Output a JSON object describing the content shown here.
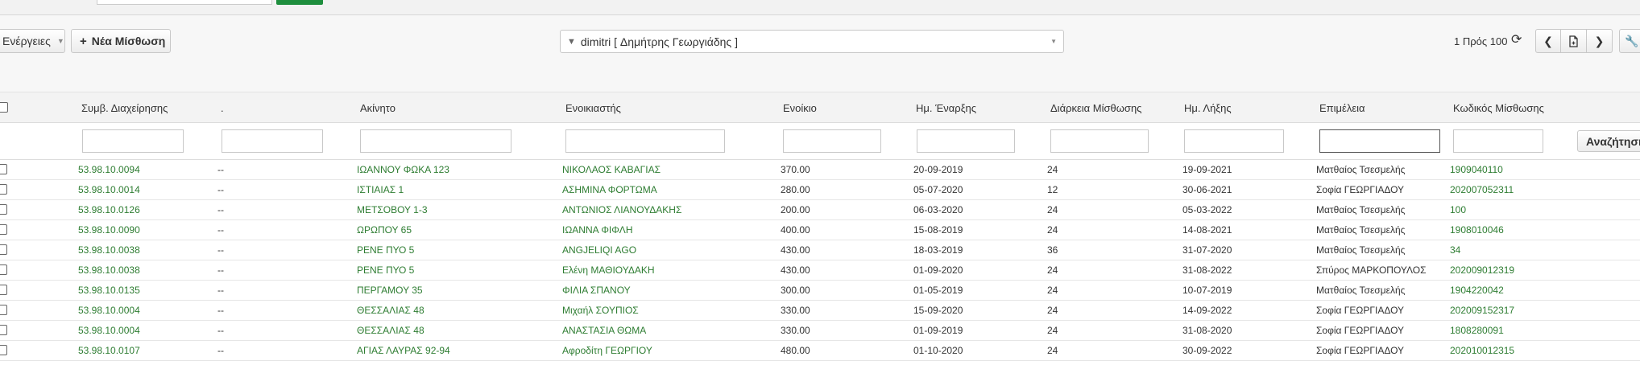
{
  "toolbar": {
    "actions_label": "Ενέργειες",
    "new_lease_label": "Νέα Μίσθωση",
    "filter_value": "dimitri [ Δημήτρης Γεωργιάδης ]",
    "pager_text": "1 Πρός 100"
  },
  "table": {
    "headers": {
      "contract": "Συμβ. Διαχείρησης",
      "dot": ".",
      "property": "Ακίνητο",
      "tenant": "Ενοικιαστής",
      "rent": "Ενοίκιο",
      "start": "Ημ. Έναρξης",
      "duration": "Διάρκεια Μίσθωσης",
      "end": "Ημ. Λήξης",
      "caretaker": "Επιμέλεια",
      "code": "Κωδικός Μίσθωσης"
    },
    "search_label": "Αναζήτηση",
    "rows": [
      {
        "contract": "53.98.10.0094",
        "dot": "--",
        "property": "ΙΩΑΝΝΟΥ ΦΩΚΑ 123",
        "tenant": "ΝΙΚΟΛΑΟΣ ΚΑΒΑΓΙΑΣ",
        "rent": "370.00",
        "start": "20-09-2019",
        "duration": "24",
        "end": "19-09-2021",
        "caretaker": "Ματθαίος Τσεσμελής",
        "code": "1909040110"
      },
      {
        "contract": "53.98.10.0014",
        "dot": "--",
        "property": "ΙΣΤΙΑΙΑΣ 1",
        "tenant": "ΑΣΗΜΙΝΑ ΦΟΡΤΩΜΑ",
        "rent": "280.00",
        "start": "05-07-2020",
        "duration": "12",
        "end": "30-06-2021",
        "caretaker": "Σοφία ΓΕΩΡΓΙΑΔΟΥ",
        "code": "202007052311"
      },
      {
        "contract": "53.98.10.0126",
        "dot": "--",
        "property": "ΜΕΤΣΟΒΟΥ 1-3",
        "tenant": "ΑΝΤΩΝΙΟΣ ΛΙΑΝΟΥΔΑΚΗΣ",
        "rent": "200.00",
        "start": "06-03-2020",
        "duration": "24",
        "end": "05-03-2022",
        "caretaker": "Ματθαίος Τσεσμελής",
        "code": "100"
      },
      {
        "contract": "53.98.10.0090",
        "dot": "--",
        "property": "ΩΡΩΠΟΥ 65",
        "tenant": "ΙΩΑΝΝΑ ΦΙΦΛΗ",
        "rent": "400.00",
        "start": "15-08-2019",
        "duration": "24",
        "end": "14-08-2021",
        "caretaker": "Ματθαίος Τσεσμελής",
        "code": "1908010046"
      },
      {
        "contract": "53.98.10.0038",
        "dot": "--",
        "property": "ΡΕΝΕ ΠΥΟ 5",
        "tenant": "ANGJELIQI AGO",
        "rent": "430.00",
        "start": "18-03-2019",
        "duration": "36",
        "end": "31-07-2020",
        "caretaker": "Ματθαίος Τσεσμελής",
        "code": "34"
      },
      {
        "contract": "53.98.10.0038",
        "dot": "--",
        "property": "ΡΕΝΕ ΠΥΟ 5",
        "tenant": "Ελένη ΜΑΘΙΟΥΔΑΚΗ",
        "rent": "430.00",
        "start": "01-09-2020",
        "duration": "24",
        "end": "31-08-2022",
        "caretaker": "Σπύρος ΜΑΡΚΟΠΟΥΛΟΣ",
        "code": "202009012319"
      },
      {
        "contract": "53.98.10.0135",
        "dot": "--",
        "property": "ΠΕΡΓΑΜΟΥ 35",
        "tenant": "ΦΙΛΙΑ ΣΠΑΝΟΥ",
        "rent": "300.00",
        "start": "01-05-2019",
        "duration": "24",
        "end": "10-07-2019",
        "caretaker": "Ματθαίος Τσεσμελής",
        "code": "1904220042"
      },
      {
        "contract": "53.98.10.0004",
        "dot": "--",
        "property": "ΘΕΣΣΑΛΙΑΣ 48",
        "tenant": "Μιχαήλ ΣΟΥΠΙΟΣ",
        "rent": "330.00",
        "start": "15-09-2020",
        "duration": "24",
        "end": "14-09-2022",
        "caretaker": "Σοφία ΓΕΩΡΓΙΑΔΟΥ",
        "code": "202009152317"
      },
      {
        "contract": "53.98.10.0004",
        "dot": "--",
        "property": "ΘΕΣΣΑΛΙΑΣ 48",
        "tenant": "ΑΝΑΣΤΑΣΙΑ ΘΩΜΑ",
        "rent": "330.00",
        "start": "01-09-2019",
        "duration": "24",
        "end": "31-08-2020",
        "caretaker": "Σοφία ΓΕΩΡΓΙΑΔΟΥ",
        "code": "1808280091"
      },
      {
        "contract": "53.98.10.0107",
        "dot": "--",
        "property": "ΑΓΙΑΣ ΛΑΥΡΑΣ 92-94",
        "tenant": "Αφροδίτη ΓΕΩΡΓΙΟΥ",
        "rent": "480.00",
        "start": "01-10-2020",
        "duration": "24",
        "end": "30-09-2022",
        "caretaker": "Σοφία ΓΕΩΡΓΙΑΔΟΥ",
        "code": "202010012315"
      }
    ]
  }
}
